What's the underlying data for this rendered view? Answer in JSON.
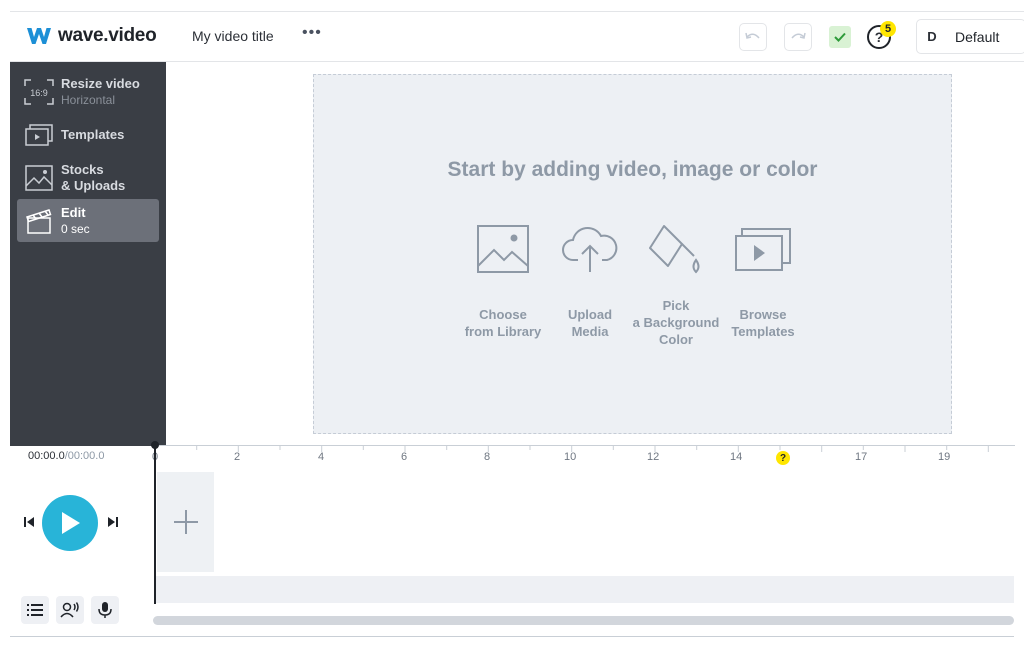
{
  "header": {
    "brand": "wave.video",
    "video_title": "My video title",
    "more_label": "•••",
    "help_label": "?",
    "help_badge": "5",
    "profile_initial": "D",
    "profile_name": "Default"
  },
  "sidebar": {
    "items": [
      {
        "label": "Resize video",
        "sub": "Horizontal",
        "icon": "aspect-ratio-icon",
        "icon_text": "16:9"
      },
      {
        "label": "Templates",
        "sub": "",
        "icon": "templates-icon"
      },
      {
        "label": "Stocks",
        "label2": "& Uploads",
        "icon": "image-icon"
      },
      {
        "label": "Edit",
        "sub": "0 sec",
        "icon": "clapperboard-icon",
        "active": true
      }
    ]
  },
  "canvas": {
    "title": "Start by adding video, image or color",
    "options": [
      {
        "line1": "Choose",
        "line2": "from Library",
        "line3": "",
        "icon": "image-library-icon"
      },
      {
        "line1": "Upload",
        "line2": "Media",
        "line3": "",
        "icon": "cloud-upload-icon"
      },
      {
        "line1": "Pick",
        "line2": "a Background",
        "line3": "Color",
        "icon": "paint-bucket-icon"
      },
      {
        "line1": "Browse",
        "line2": "Templates",
        "line3": "",
        "icon": "templates-icon"
      }
    ]
  },
  "timeline": {
    "current_time": "00:00.0",
    "separator": "/",
    "duration": "00:00.0",
    "ticks": [
      "0",
      "2",
      "4",
      "6",
      "8",
      "10",
      "12",
      "14",
      "17",
      "19"
    ],
    "help_marker": "?"
  },
  "colors": {
    "accent": "#28b4d8",
    "sidebar_bg": "#3a3e45",
    "badge": "#ffe600"
  }
}
